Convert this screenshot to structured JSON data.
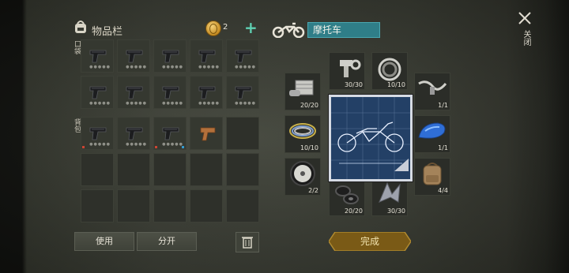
{
  "inventory": {
    "title": "物品栏",
    "coins": "2",
    "pocket_label": "口袋",
    "backpack_label": "背包",
    "gun_count": 13,
    "use_label": "使用",
    "split_label": "分开"
  },
  "vehicle": {
    "name": "摩托车",
    "parts": [
      {
        "name": "engine-part",
        "count": "20/20"
      },
      {
        "name": "bolt-part",
        "count": "30/30"
      },
      {
        "name": "bearing-part",
        "count": "10/10"
      },
      {
        "name": "handlebar-part",
        "count": "1/1"
      },
      {
        "name": "wire-part",
        "count": "10/10"
      },
      {
        "name": "fuel-tank-part",
        "count": "1/1"
      },
      {
        "name": "wheel-part",
        "count": "2/2"
      },
      {
        "name": "gasket-part",
        "count": "20/20"
      },
      {
        "name": "metal-scrap-part",
        "count": "30/30"
      },
      {
        "name": "backpack-part",
        "count": "4/4"
      }
    ],
    "done_label": "完成"
  },
  "close_label": "关闭",
  "colors": {
    "accent": "#2f7e88",
    "plus": "#5fd0b2",
    "done": "#7a5a16"
  }
}
